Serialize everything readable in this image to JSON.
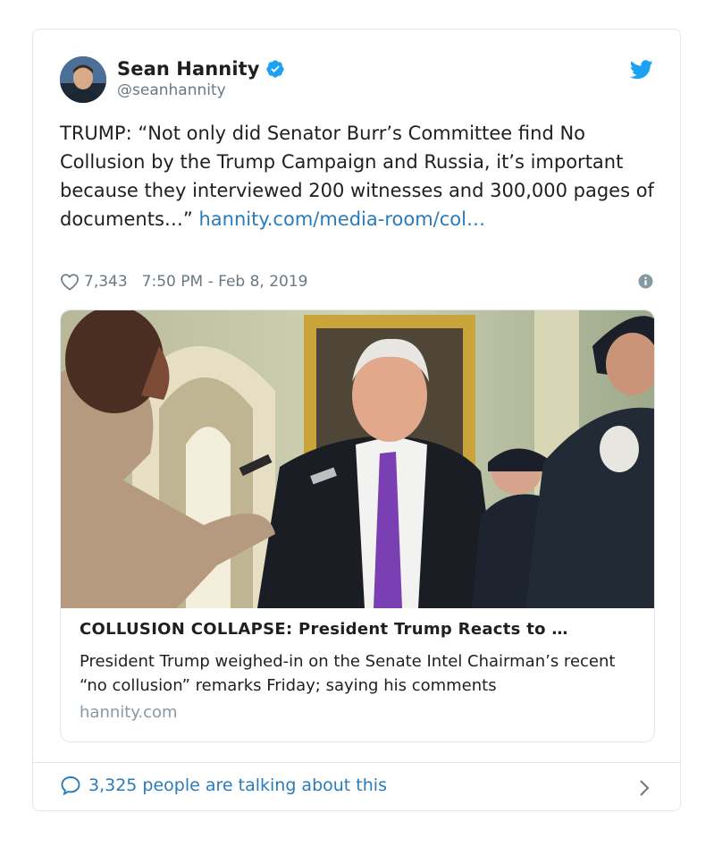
{
  "author": {
    "name": "Sean Hannity",
    "handle": "@seanhannity",
    "verified": true
  },
  "tweet": {
    "text": "TRUMP: “Not only did Senator Burr’s Committee find No Collusion by the Trump Campaign and Russia, it’s important because they interviewed 200 witnesses and 300,000 pages of documents…” ",
    "link_text": "hannity.com/media-room/col…"
  },
  "meta": {
    "likes": "7,343",
    "timestamp": "7:50 PM - Feb 8, 2019"
  },
  "media_card": {
    "title": "COLLUSION COLLAPSE: President Trump Reacts to …",
    "description": "President Trump weighed-in on the Senate Intel Chairman’s recent “no collusion” remarks Friday; saying his comments",
    "domain": "hannity.com"
  },
  "footer": {
    "talking_text": "3,325 people are talking about this"
  },
  "colors": {
    "link": "#2b7bb9",
    "secondary": "#697882",
    "verified": "#1da1f2",
    "border": "#e1e8ed"
  },
  "icons": [
    "verified-badge-icon",
    "twitter-bird-icon",
    "heart-icon",
    "info-icon",
    "speech-bubble-icon",
    "chevron-right-icon"
  ]
}
